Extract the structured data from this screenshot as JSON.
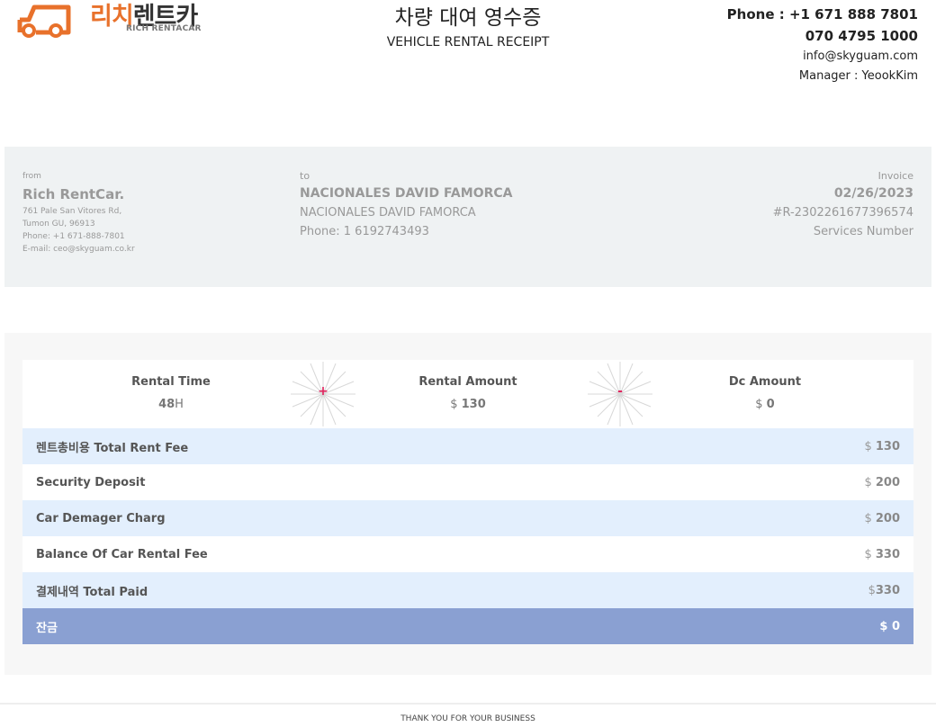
{
  "brand": {
    "logo_ko_accent": "리치",
    "logo_ko_rest": "렌트카",
    "logo_en": "RICH RENTACAR",
    "accent_color": "#e8712b"
  },
  "header": {
    "title_ko": "차량 대여 영수증",
    "title_en": "VEHICLE RENTAL RECEIPT",
    "phone1": "Phone : +1 671 888 7801",
    "phone2": "070 4795 1000",
    "email": "info@skyguam.com",
    "manager": "Manager : YeookKim"
  },
  "from": {
    "label": "from",
    "name": "Rich RentCar.",
    "address1": "761 Pale San Vitores Rd,",
    "address2": "Tumon GU, 96913",
    "phone": "Phone: +1 671-888-7801",
    "email": "E-mail: ceo@skyguam.co.kr"
  },
  "to": {
    "label": "to",
    "name": "NACIONALES DAVID FAMORCA",
    "name2": "NACIONALES DAVID FAMORCA",
    "phone": "Phone: 1 6192743493"
  },
  "invoice": {
    "label": "Invoice",
    "date": "02/26/2023",
    "number": "#R-2302261677396574",
    "services": "Services Number"
  },
  "stats": {
    "rental_time": {
      "label": "Rental Time",
      "value": "48",
      "unit": "H"
    },
    "plus_symbol": "+",
    "rental_amount": {
      "label": "Rental Amount",
      "currency": "$ ",
      "value": "130"
    },
    "minus_symbol": "-",
    "dc_amount": {
      "label": "Dc Amount",
      "currency": "$ ",
      "value": "0"
    }
  },
  "rows": [
    {
      "label": "렌트총비용 Total Rent Fee",
      "currency": "$ ",
      "value": "130"
    },
    {
      "label": "Security Deposit",
      "currency": "$ ",
      "value": "200"
    },
    {
      "label": "Car Demager Charg",
      "currency": "$ ",
      "value": "200"
    },
    {
      "label": "Balance Of Car Rental Fee",
      "currency": "$ ",
      "value": "330"
    },
    {
      "label": "결제내역 Total Paid",
      "currency": "$",
      "value": "330"
    }
  ],
  "balance": {
    "label": "잔금",
    "value": "$ 0",
    "color": "#8aa0d2"
  },
  "footer": {
    "text": "THANK YOU FOR YOUR BUSINESS"
  }
}
